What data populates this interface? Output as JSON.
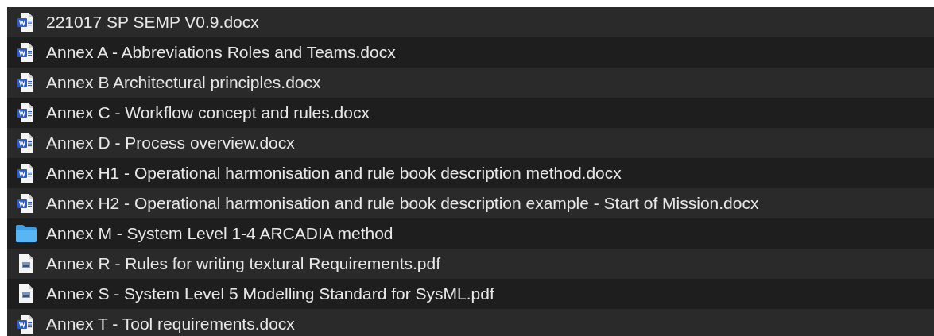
{
  "files": [
    {
      "name": "221017 SP SEMP V0.9.docx",
      "kind": "word"
    },
    {
      "name": "Annex A - Abbreviations Roles and Teams.docx",
      "kind": "word"
    },
    {
      "name": "Annex B Architectural principles.docx",
      "kind": "word"
    },
    {
      "name": "Annex C - Workflow concept and rules.docx",
      "kind": "word"
    },
    {
      "name": "Annex D - Process overview.docx",
      "kind": "word"
    },
    {
      "name": "Annex H1 - Operational harmonisation and rule book description method.docx",
      "kind": "word"
    },
    {
      "name": "Annex H2 - Operational harmonisation and rule book description example - Start of Mission.docx",
      "kind": "word"
    },
    {
      "name": "Annex M - System Level 1-4 ARCADIA method",
      "kind": "folder"
    },
    {
      "name": "Annex R - Rules for writing textural Requirements.pdf",
      "kind": "pdf"
    },
    {
      "name": "Annex S - System Level 5 Modelling Standard for SysML.pdf",
      "kind": "pdf"
    },
    {
      "name": "Annex T - Tool requirements.docx",
      "kind": "word"
    }
  ]
}
